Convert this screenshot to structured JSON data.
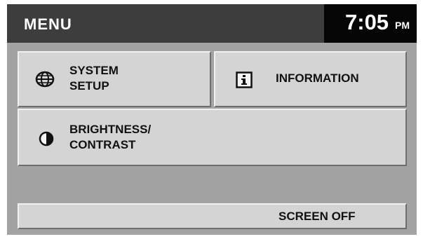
{
  "header": {
    "title": "MENU",
    "time": "7:05",
    "ampm": "PM"
  },
  "buttons": {
    "system_setup": {
      "label": "SYSTEM\nSETUP",
      "icon": "globe-icon"
    },
    "information": {
      "label": "INFORMATION",
      "icon": "info-icon"
    },
    "brightness_contrast": {
      "label": "BRIGHTNESS/\nCONTRAST",
      "icon": "contrast-icon"
    },
    "screen_off": {
      "label": "SCREEN OFF"
    }
  },
  "colors": {
    "header_bg": "#3d3d3d",
    "clock_bg": "#050505",
    "screen_bg": "#a3a3a3",
    "button_bg": "#d4d4d4"
  }
}
